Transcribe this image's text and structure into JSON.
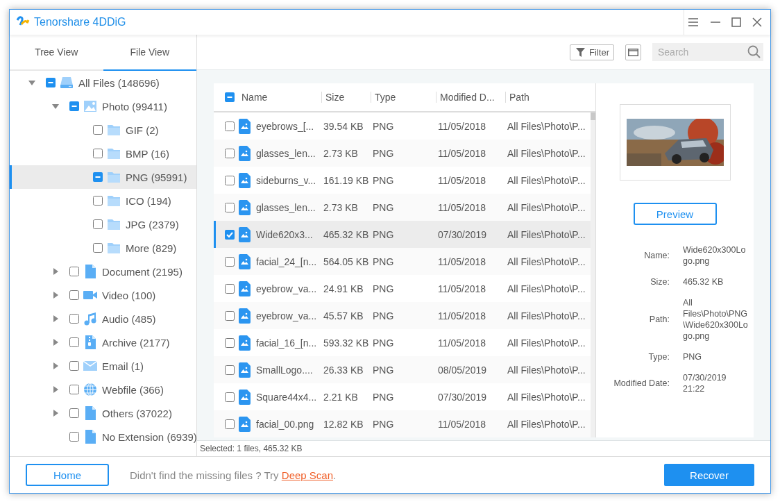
{
  "window": {
    "title": "Tenorshare 4DDiG"
  },
  "sidebar": {
    "tabs": [
      {
        "label": "Tree View",
        "selected": false
      },
      {
        "label": "File View",
        "selected": true
      }
    ],
    "tree": [
      {
        "label": "All Files (148696)",
        "kind": "drive",
        "checked": false,
        "mixed": true,
        "expanded": true,
        "selected": false,
        "children": [
          {
            "label": "Photo (99411)",
            "checked": false,
            "mixed": true,
            "expanded": true,
            "selected": false,
            "children": [
              {
                "label": "GIF (2)",
                "kind": "folder",
                "checked": false,
                "mixed": false,
                "selected": false
              },
              {
                "label": "BMP (16)",
                "kind": "folder",
                "checked": false,
                "mixed": false,
                "selected": false
              },
              {
                "label": "PNG (95991)",
                "kind": "folder",
                "checked": false,
                "mixed": true,
                "selected": true
              },
              {
                "label": "ICO (194)",
                "kind": "folder",
                "checked": false,
                "mixed": false,
                "selected": false
              },
              {
                "label": "JPG (2379)",
                "kind": "folder",
                "checked": false,
                "mixed": false,
                "selected": false
              },
              {
                "label": "More (829)",
                "kind": "folder",
                "checked": false,
                "mixed": false,
                "selected": false
              }
            ]
          },
          {
            "label": "Document (2195)",
            "kind": "document",
            "checked": false,
            "mixed": false,
            "expanded": false,
            "selected": false
          },
          {
            "label": "Video (100)",
            "kind": "video",
            "checked": false,
            "mixed": false,
            "expanded": false,
            "selected": false
          },
          {
            "label": "Audio (485)",
            "kind": "audio",
            "checked": false,
            "mixed": false,
            "expanded": false,
            "selected": false
          },
          {
            "label": "Archive (2177)",
            "kind": "archive",
            "checked": false,
            "mixed": false,
            "expanded": false,
            "selected": false
          },
          {
            "label": "Email (1)",
            "kind": "email",
            "checked": false,
            "mixed": false,
            "expanded": false,
            "selected": false
          },
          {
            "label": "Webfile (366)",
            "kind": "web",
            "checked": false,
            "mixed": false,
            "expanded": false,
            "selected": false
          },
          {
            "label": "Others (37022)",
            "kind": "document",
            "checked": false,
            "mixed": false,
            "expanded": false,
            "selected": false
          },
          {
            "label": "No Extension (6939)",
            "kind": "document",
            "checked": false,
            "mixed": false,
            "selected": false
          }
        ]
      }
    ]
  },
  "toolbar": {
    "filter_button": "Filter",
    "search": {
      "placeholder": "Search"
    }
  },
  "table": {
    "header_checked": false,
    "header_mixed": true,
    "columns": [
      "Name",
      "Size",
      "Type",
      "Modified D...",
      "Path"
    ],
    "rows": [
      {
        "name": "eyebrows_[...",
        "size": "39.54 KB",
        "type": "PNG",
        "modified": "11/05/2018",
        "path": "All Files\\Photo\\P...",
        "checked": false,
        "selected": false
      },
      {
        "name": "glasses_len...",
        "size": "2.73 KB",
        "type": "PNG",
        "modified": "11/05/2018",
        "path": "All Files\\Photo\\P...",
        "checked": false,
        "selected": false
      },
      {
        "name": "sideburns_v...",
        "size": "161.19 KB",
        "type": "PNG",
        "modified": "11/05/2018",
        "path": "All Files\\Photo\\P...",
        "checked": false,
        "selected": false
      },
      {
        "name": "glasses_len...",
        "size": "2.73 KB",
        "type": "PNG",
        "modified": "11/05/2018",
        "path": "All Files\\Photo\\P...",
        "checked": false,
        "selected": false
      },
      {
        "name": "Wide620x3...",
        "size": "465.32 KB",
        "type": "PNG",
        "modified": "07/30/2019",
        "path": "All Files\\Photo\\P...",
        "checked": true,
        "selected": true
      },
      {
        "name": "facial_24_[n...",
        "size": "564.05 KB",
        "type": "PNG",
        "modified": "11/05/2018",
        "path": "All Files\\Photo\\P...",
        "checked": false,
        "selected": false
      },
      {
        "name": "eyebrow_va...",
        "size": "24.91 KB",
        "type": "PNG",
        "modified": "11/05/2018",
        "path": "All Files\\Photo\\P...",
        "checked": false,
        "selected": false
      },
      {
        "name": "eyebrow_va...",
        "size": "45.57 KB",
        "type": "PNG",
        "modified": "11/05/2018",
        "path": "All Files\\Photo\\P...",
        "checked": false,
        "selected": false
      },
      {
        "name": "facial_16_[n...",
        "size": "593.32 KB",
        "type": "PNG",
        "modified": "11/05/2018",
        "path": "All Files\\Photo\\P...",
        "checked": false,
        "selected": false
      },
      {
        "name": "SmallLogo....",
        "size": "26.33 KB",
        "type": "PNG",
        "modified": "08/05/2019",
        "path": "All Files\\Photo\\P...",
        "checked": false,
        "selected": false
      },
      {
        "name": "Square44x4...",
        "size": "2.21 KB",
        "type": "PNG",
        "modified": "07/30/2019",
        "path": "All Files\\Photo\\P...",
        "checked": false,
        "selected": false
      },
      {
        "name": "facial_00.png",
        "size": "12.82 KB",
        "type": "PNG",
        "modified": "11/05/2018",
        "path": "All Files\\Photo\\P...",
        "checked": false,
        "selected": false
      }
    ]
  },
  "details": {
    "preview_button": "Preview",
    "fields": [
      {
        "label": "Name:",
        "value": "Wide620x300Logo.png"
      },
      {
        "label": "Size:",
        "value": "465.32 KB"
      },
      {
        "label": "Path:",
        "value": "All Files\\Photo\\PNG\\Wide620x300Logo.png"
      },
      {
        "label": "Type:",
        "value": "PNG"
      },
      {
        "label": "Modified Date:",
        "value": "07/30/2019 21:22"
      }
    ]
  },
  "status_bar": "Selected: 1 files, 465.32 KB",
  "footer": {
    "home_button": "Home",
    "hint": "Didn't find the missing files ? Try ",
    "link": "Deep Scan",
    "hint_end": ".",
    "recover_button": "Recover"
  }
}
